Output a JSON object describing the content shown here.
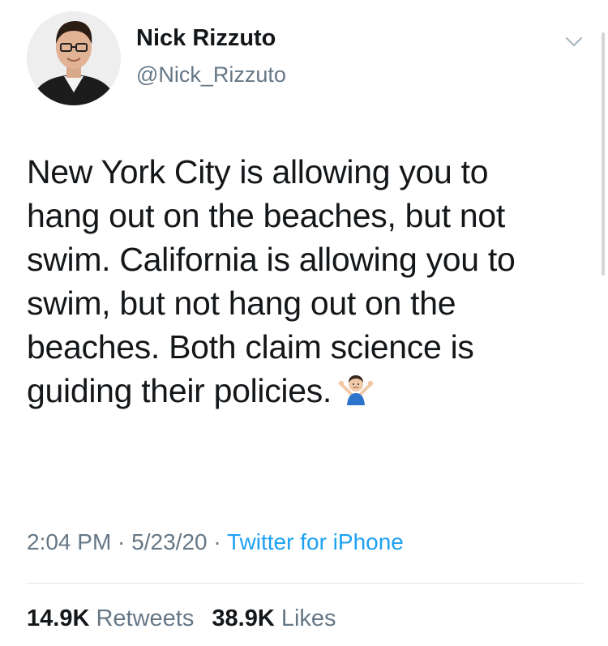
{
  "author": {
    "name": "Nick Rizzuto",
    "handle": "@Nick_Rizzuto",
    "avatar_icon": "profile-photo"
  },
  "tweet": {
    "lines": [
      "New York City is allowing you to",
      "hang out on the beaches, but not",
      "swim. California is allowing you to",
      "swim, but not hang out on the",
      "beaches. Both claim science is",
      "guiding their policies."
    ],
    "emoji": "man-shrugging-emoji"
  },
  "meta": {
    "time": "2:04 PM",
    "sep1": " · ",
    "date": "5/23/20",
    "sep2": " · ",
    "source": "Twitter for iPhone"
  },
  "stats": {
    "retweets_count": "14.9K",
    "retweets_label": "Retweets",
    "likes_count": "38.9K",
    "likes_label": "Likes"
  },
  "colors": {
    "text": "#14171a",
    "secondary": "#657786",
    "link": "#1da1f2",
    "divider": "#e1e8ed"
  },
  "menu": {
    "icon": "chevron-down-icon"
  }
}
